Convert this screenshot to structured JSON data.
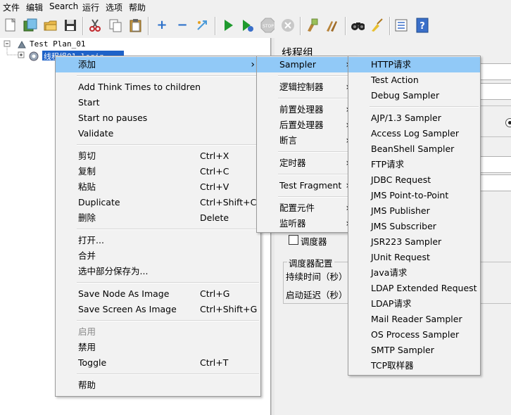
{
  "menubar": [
    "文件",
    "编辑",
    "Search",
    "运行",
    "选项",
    "帮助"
  ],
  "toolbar": {
    "icons": [
      "new-icon",
      "templates-icon",
      "open-icon",
      "save-icon",
      "cut-icon",
      "copy-icon",
      "paste-icon",
      "expand-icon",
      "collapse-icon",
      "toggle-icon",
      "start-icon",
      "start-no-pause-icon",
      "stop-icon",
      "shutdown-icon",
      "clear-icon",
      "clear-all-icon",
      "search-icon",
      "reset-search-icon",
      "function-helper-icon",
      "help-icon"
    ]
  },
  "tree": {
    "root_label": "Test Plan_01",
    "child_label": "线程组01-login"
  },
  "right_panel": {
    "title": "线程组",
    "scheduler_checkbox": "调度器",
    "scheduler_group": "调度器配置",
    "duration_label": "持续时间（秒）",
    "delay_label": "启动延迟（秒）"
  },
  "context_menu": {
    "items": [
      {
        "label": "添加",
        "submenu": true,
        "highlight": true
      },
      {
        "sep": true
      },
      {
        "label": "Add Think Times to children"
      },
      {
        "label": "Start"
      },
      {
        "label": "Start no pauses"
      },
      {
        "label": "Validate"
      },
      {
        "sep": true
      },
      {
        "label": "剪切",
        "accel": "Ctrl+X"
      },
      {
        "label": "复制",
        "accel": "Ctrl+C"
      },
      {
        "label": "粘贴",
        "accel": "Ctrl+V"
      },
      {
        "label": "Duplicate",
        "accel": "Ctrl+Shift+C"
      },
      {
        "label": "删除",
        "accel": "Delete"
      },
      {
        "sep": true
      },
      {
        "label": "打开..."
      },
      {
        "label": "合并"
      },
      {
        "label": "选中部分保存为..."
      },
      {
        "sep": true
      },
      {
        "label": "Save Node As Image",
        "accel": "Ctrl+G"
      },
      {
        "label": "Save Screen As Image",
        "accel": "Ctrl+Shift+G"
      },
      {
        "sep": true
      },
      {
        "label": "启用",
        "disabled": true
      },
      {
        "label": "禁用"
      },
      {
        "label": "Toggle",
        "accel": "Ctrl+T"
      },
      {
        "sep": true
      },
      {
        "label": "帮助"
      }
    ]
  },
  "add_menu": {
    "items": [
      {
        "label": "Sampler",
        "submenu": true,
        "highlight": true
      },
      {
        "sep": true
      },
      {
        "label": "逻辑控制器",
        "submenu": true
      },
      {
        "sep": true
      },
      {
        "label": "前置处理器",
        "submenu": true
      },
      {
        "label": "后置处理器",
        "submenu": true
      },
      {
        "label": "断言",
        "submenu": true
      },
      {
        "sep": true
      },
      {
        "label": "定时器",
        "submenu": true
      },
      {
        "sep": true
      },
      {
        "label": "Test Fragment",
        "submenu": true
      },
      {
        "sep": true
      },
      {
        "label": "配置元件",
        "submenu": true
      },
      {
        "label": "监听器",
        "submenu": true
      }
    ]
  },
  "sampler_menu": {
    "items": [
      {
        "label": "HTTP请求",
        "highlight": true
      },
      {
        "label": "Test Action"
      },
      {
        "label": "Debug Sampler"
      },
      {
        "sep": true
      },
      {
        "label": "AJP/1.3 Sampler"
      },
      {
        "label": "Access Log Sampler"
      },
      {
        "label": "BeanShell Sampler"
      },
      {
        "label": "FTP请求"
      },
      {
        "label": "JDBC Request"
      },
      {
        "label": "JMS Point-to-Point"
      },
      {
        "label": "JMS Publisher"
      },
      {
        "label": "JMS Subscriber"
      },
      {
        "label": "JSR223 Sampler"
      },
      {
        "label": "JUnit Request"
      },
      {
        "label": "Java请求"
      },
      {
        "label": "LDAP Extended Request"
      },
      {
        "label": "LDAP请求"
      },
      {
        "label": "Mail Reader Sampler"
      },
      {
        "label": "OS Process Sampler"
      },
      {
        "label": "SMTP Sampler"
      },
      {
        "label": "TCP取样器"
      }
    ]
  }
}
